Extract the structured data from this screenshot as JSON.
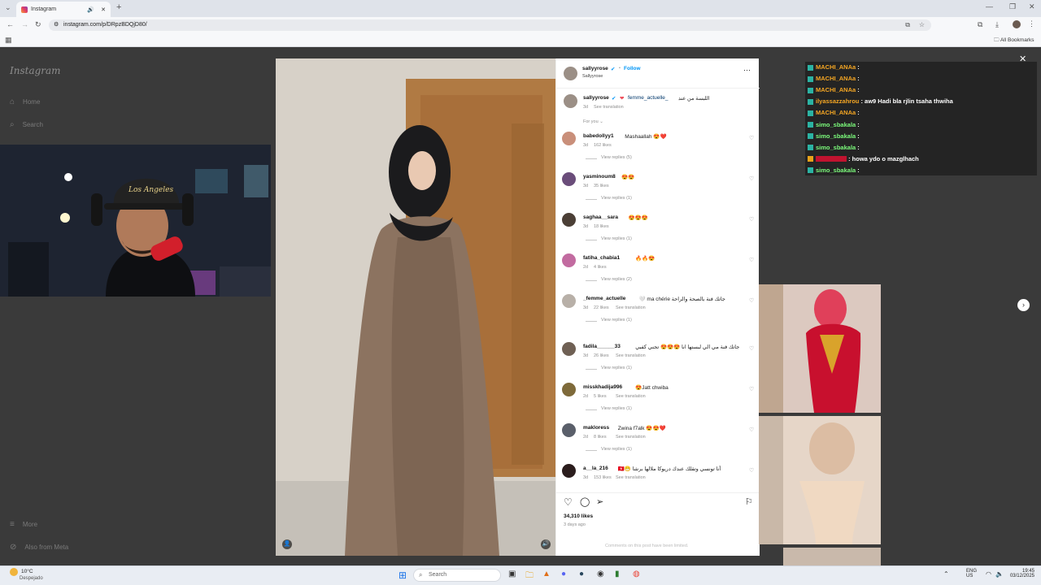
{
  "browser": {
    "tab_title": "Instagram",
    "url": "instagram.com/p/DRpzBDQjD80/",
    "all_bookmarks": "All Bookmarks"
  },
  "sidebar": {
    "logo": "Instagram",
    "home": "Home",
    "search": "Search",
    "more": "More",
    "also_from_meta": "Also from Meta"
  },
  "post": {
    "username": "sallyyrose",
    "follow": "Follow",
    "subtitle": "Sallyyrose",
    "caption_user": "sallyyrose",
    "caption_mention": "femme_actuelle_",
    "caption_text": "اللبسة من عند",
    "caption_time": "3d",
    "see_translation": "See translation",
    "for_you": "For you",
    "likes": "34,310 likes",
    "date": "3 days ago",
    "comments_limited": "Comments on this post have been limited."
  },
  "comments": [
    {
      "user": "babedollyy1",
      "text": "Mashaallah 😍❤️",
      "time": "3d",
      "likes": "162 likes",
      "translation": "",
      "replies": "View replies (5)"
    },
    {
      "user": "yasminoum8",
      "text": "😍😍",
      "time": "3d",
      "likes": "35 likes",
      "translation": "",
      "replies": "View replies (1)"
    },
    {
      "user": "saghaa__sara",
      "text": "😍😍😍",
      "time": "3d",
      "likes": "18 likes",
      "translation": "",
      "replies": "View replies (1)"
    },
    {
      "user": "fatiha_chabia1",
      "text": "🔥🔥😍",
      "time": "2d",
      "likes": "4 likes",
      "translation": "",
      "replies": "View replies (2)"
    },
    {
      "user": "_femme_actuelle",
      "text": "🤍 ma chérie جاتك فنة بالصحة والراحة",
      "time": "3d",
      "likes": "22 likes",
      "translation": "See translation",
      "replies": "View replies (1)"
    },
    {
      "user": "fadila______33",
      "text": "حبيبيت لبسة 😍 ناري جاتك فنة مي الي لبستها انا 😍😍😍 تجني كفبي",
      "time": "3d",
      "likes": "26 likes",
      "translation": "See translation",
      "replies": "View replies (1)"
    },
    {
      "user": "misskhadija996",
      "text": "😍Jatt chwiba",
      "time": "2d",
      "likes": "5 likes",
      "translation": "See translation",
      "replies": "View replies (1)"
    },
    {
      "user": "makloress",
      "text": "Zwina f7alk 😍😍❤️",
      "time": "2d",
      "likes": "8 likes",
      "translation": "See translation",
      "replies": "View replies (1)"
    },
    {
      "user": "a__la_216",
      "text": "🇹🇳😁 أنا تونسي وتقلك عندك دريوكا ملالها برشا",
      "time": "3d",
      "likes": "153 likes",
      "translation": "See translation",
      "replies": ""
    }
  ],
  "chat": [
    {
      "user": "MACHI_ANAa",
      "msg": ":",
      "color": "#f5a623"
    },
    {
      "user": "MACHI_ANAa",
      "msg": ":",
      "color": "#f5a623"
    },
    {
      "user": "MACHI_ANAa",
      "msg": ":",
      "color": "#f5a623"
    },
    {
      "user": "ilyassazzahrou",
      "msg": ": aw9 Hadi bla rjlin tsaha thwiha",
      "color": "#f5a623"
    },
    {
      "user": "MACHI_ANAa",
      "msg": ":",
      "color": "#f5a623"
    },
    {
      "user": "simo_sbakala",
      "msg": ":",
      "color": "#7cfc7c"
    },
    {
      "user": "simo_sbakala",
      "msg": ":",
      "color": "#7cfc7c"
    },
    {
      "user": "simo_sbakala",
      "msg": ":",
      "color": "#7cfc7c"
    },
    {
      "user": "",
      "msg": ": howa ydo o mazglhach",
      "color": "#c0132f"
    },
    {
      "user": "simo_sbakala",
      "msg": ":",
      "color": "#7cfc7c"
    }
  ],
  "taskbar": {
    "weather_temp": "10°C",
    "weather_desc": "Despejado",
    "search": "Search",
    "lang": "ENG",
    "region": "US",
    "time": "19:45",
    "date": "03/12/2025"
  }
}
